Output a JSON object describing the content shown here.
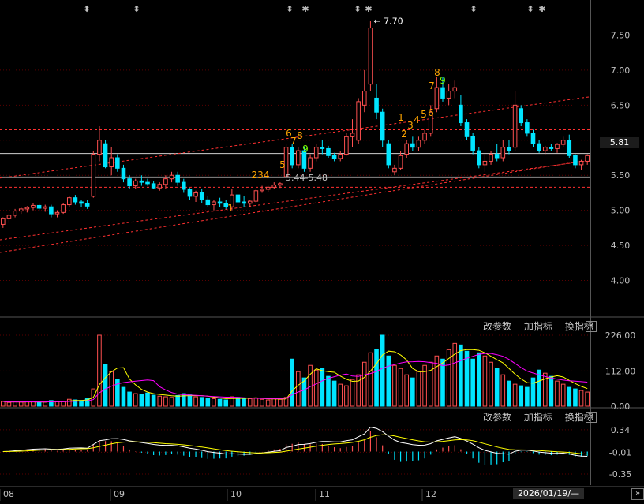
{
  "chart_data": [
    {
      "type": "candlestick",
      "title": "",
      "ylim": [
        3.5,
        8.0
      ],
      "y_ticks": [
        "7.50",
        "7.00",
        "6.50",
        "6.00",
        "5.50",
        "5.00",
        "4.50",
        "4.00"
      ],
      "y_tick_values": [
        7.5,
        7.0,
        6.5,
        6.0,
        5.5,
        5.0,
        4.5,
        4.0
      ],
      "x_ticks": [
        "08",
        "09",
        "10",
        "11",
        "12"
      ],
      "last_price": "5.81",
      "peak_label": "7.70",
      "range_label": "5.44-5.48",
      "horizontal_lines": [
        6.15,
        5.81,
        5.47,
        5.33
      ],
      "candles": [
        [
          4.8,
          4.9,
          4.75,
          4.88
        ],
        [
          4.88,
          4.95,
          4.82,
          4.93
        ],
        [
          4.93,
          5.02,
          4.9,
          4.99
        ],
        [
          4.99,
          5.05,
          4.95,
          5.02
        ],
        [
          5.02,
          5.06,
          4.97,
          5.04
        ],
        [
          5.04,
          5.1,
          5.0,
          5.07
        ],
        [
          5.07,
          5.09,
          5.0,
          5.03
        ],
        [
          5.03,
          5.08,
          4.98,
          5.05
        ],
        [
          5.05,
          5.08,
          4.9,
          4.95
        ],
        [
          4.95,
          5.0,
          4.9,
          4.97
        ],
        [
          4.97,
          5.1,
          4.95,
          5.08
        ],
        [
          5.08,
          5.2,
          5.05,
          5.18
        ],
        [
          5.18,
          5.22,
          5.08,
          5.12
        ],
        [
          5.12,
          5.15,
          5.05,
          5.1
        ],
        [
          5.1,
          5.15,
          5.02,
          5.06
        ],
        [
          5.2,
          5.85,
          5.18,
          5.8
        ],
        [
          5.8,
          6.2,
          5.7,
          6.0
        ],
        [
          5.95,
          6.0,
          5.6,
          5.62
        ],
        [
          5.62,
          5.9,
          5.5,
          5.75
        ],
        [
          5.75,
          5.8,
          5.55,
          5.6
        ],
        [
          5.6,
          5.65,
          5.4,
          5.45
        ],
        [
          5.45,
          5.5,
          5.3,
          5.35
        ],
        [
          5.35,
          5.45,
          5.3,
          5.42
        ],
        [
          5.42,
          5.5,
          5.35,
          5.4
        ],
        [
          5.4,
          5.45,
          5.35,
          5.38
        ],
        [
          5.38,
          5.42,
          5.3,
          5.32
        ],
        [
          5.32,
          5.4,
          5.28,
          5.37
        ],
        [
          5.37,
          5.5,
          5.3,
          5.45
        ],
        [
          5.45,
          5.55,
          5.4,
          5.5
        ],
        [
          5.5,
          5.55,
          5.35,
          5.4
        ],
        [
          5.4,
          5.45,
          5.25,
          5.3
        ],
        [
          5.3,
          5.32,
          5.15,
          5.2
        ],
        [
          5.2,
          5.28,
          5.12,
          5.25
        ],
        [
          5.25,
          5.3,
          5.1,
          5.15
        ],
        [
          5.15,
          5.2,
          5.05,
          5.08
        ],
        [
          5.08,
          5.15,
          5.0,
          5.12
        ],
        [
          5.12,
          5.18,
          5.05,
          5.1
        ],
        [
          5.1,
          5.15,
          5.02,
          5.05
        ],
        [
          5.05,
          5.3,
          5.0,
          5.22
        ],
        [
          5.22,
          5.25,
          5.1,
          5.12
        ],
        [
          5.12,
          5.2,
          5.05,
          5.1
        ],
        [
          5.1,
          5.15,
          5.05,
          5.13
        ],
        [
          5.13,
          5.3,
          5.1,
          5.28
        ],
        [
          5.28,
          5.35,
          5.25,
          5.3
        ],
        [
          5.3,
          5.35,
          5.26,
          5.33
        ],
        [
          5.33,
          5.4,
          5.3,
          5.36
        ],
        [
          5.36,
          5.4,
          5.32,
          5.38
        ],
        [
          5.48,
          5.95,
          5.45,
          5.9
        ],
        [
          5.9,
          5.95,
          5.6,
          5.65
        ],
        [
          5.65,
          5.9,
          5.6,
          5.85
        ],
        [
          5.85,
          5.9,
          5.55,
          5.6
        ],
        [
          5.6,
          5.8,
          5.55,
          5.75
        ],
        [
          5.75,
          5.95,
          5.7,
          5.9
        ],
        [
          5.9,
          6.0,
          5.8,
          5.88
        ],
        [
          5.88,
          5.92,
          5.75,
          5.78
        ],
        [
          5.78,
          5.82,
          5.7,
          5.74
        ],
        [
          5.74,
          5.85,
          5.7,
          5.8
        ],
        [
          5.8,
          6.1,
          5.78,
          6.05
        ],
        [
          6.05,
          6.3,
          5.9,
          6.1
        ],
        [
          6.0,
          6.6,
          5.95,
          6.55
        ],
        [
          6.5,
          7.0,
          6.4,
          6.7
        ],
        [
          6.8,
          7.7,
          6.7,
          7.6
        ],
        [
          6.6,
          6.8,
          6.3,
          6.4
        ],
        [
          6.4,
          6.45,
          5.9,
          6.0
        ],
        [
          5.95,
          6.0,
          5.6,
          5.65
        ],
        [
          5.55,
          5.65,
          5.5,
          5.6
        ],
        [
          5.6,
          5.85,
          5.58,
          5.78
        ],
        [
          5.8,
          6.0,
          5.75,
          5.95
        ],
        [
          5.95,
          6.05,
          5.85,
          5.9
        ],
        [
          5.9,
          6.05,
          5.85,
          6.0
        ],
        [
          6.0,
          6.15,
          5.95,
          6.1
        ],
        [
          6.1,
          6.5,
          6.05,
          6.4
        ],
        [
          6.45,
          6.9,
          6.4,
          6.75
        ],
        [
          6.75,
          6.9,
          6.55,
          6.6
        ],
        [
          6.6,
          6.8,
          6.5,
          6.7
        ],
        [
          6.7,
          6.85,
          6.6,
          6.75
        ],
        [
          6.5,
          6.65,
          6.2,
          6.25
        ],
        [
          6.25,
          6.3,
          6.0,
          6.05
        ],
        [
          6.05,
          6.1,
          5.8,
          5.85
        ],
        [
          5.85,
          5.9,
          5.6,
          5.65
        ],
        [
          5.65,
          5.8,
          5.55,
          5.7
        ],
        [
          5.7,
          5.85,
          5.65,
          5.8
        ],
        [
          5.8,
          5.95,
          5.7,
          5.75
        ],
        [
          5.75,
          6.0,
          5.7,
          5.9
        ],
        [
          5.9,
          6.0,
          5.8,
          5.85
        ],
        [
          5.9,
          6.7,
          5.85,
          6.5
        ],
        [
          6.45,
          6.5,
          6.2,
          6.25
        ],
        [
          6.25,
          6.3,
          6.05,
          6.1
        ],
        [
          6.1,
          6.15,
          5.9,
          5.95
        ],
        [
          5.95,
          6.0,
          5.82,
          5.85
        ],
        [
          5.85,
          5.92,
          5.8,
          5.9
        ],
        [
          5.9,
          5.95,
          5.84,
          5.88
        ],
        [
          5.88,
          5.96,
          5.82,
          5.94
        ],
        [
          5.94,
          6.05,
          5.9,
          6.0
        ],
        [
          6.0,
          6.08,
          5.75,
          5.78
        ],
        [
          5.78,
          5.8,
          5.6,
          5.65
        ],
        [
          5.65,
          5.72,
          5.58,
          5.7
        ],
        [
          5.7,
          5.8,
          5.65,
          5.78
        ]
      ]
    },
    {
      "type": "bar",
      "title": "",
      "y_ticks": [
        "226.00",
        "112.00",
        "0.00"
      ],
      "y_tick_values": [
        226,
        112,
        0
      ],
      "ylim": [
        0,
        226
      ],
      "values": [
        15,
        12,
        14,
        13,
        15,
        14,
        12,
        13,
        18,
        14,
        16,
        22,
        20,
        18,
        24,
        55,
        226,
        132,
        110,
        85,
        60,
        45,
        40,
        38,
        42,
        35,
        32,
        30,
        28,
        34,
        40,
        36,
        30,
        28,
        26,
        24,
        22,
        20,
        30,
        28,
        26,
        24,
        26,
        22,
        20,
        24,
        22,
        28,
        150,
        110,
        90,
        130,
        115,
        120,
        95,
        80,
        70,
        65,
        85,
        100,
        140,
        170,
        180,
        226,
        160,
        130,
        120,
        100,
        90,
        110,
        130,
        140,
        160,
        150,
        180,
        200,
        195,
        175,
        150,
        170,
        160,
        140,
        120,
        100,
        80,
        70,
        65,
        60,
        90,
        115,
        105,
        95,
        80,
        70,
        60,
        55,
        50,
        45,
        40,
        38
      ],
      "ma_fast": [],
      "ma_slow": []
    },
    {
      "type": "bar",
      "title": "",
      "y_ticks": [
        "0.34",
        "-0.01",
        "-0.35"
      ],
      "y_tick_values": [
        0.34,
        -0.01,
        -0.35
      ],
      "ylim": [
        -0.4,
        0.4
      ]
    }
  ],
  "panels": {
    "volume_header": {
      "edit_params": "改参数",
      "add_indicator": "加指标",
      "switch_indicator": "换指标",
      "close": "✕"
    },
    "macd_header": {
      "edit_params": "改参数",
      "add_indicator": "加指标",
      "switch_indicator": "换指标",
      "close": "✕"
    }
  },
  "status": {
    "cursor_date": "2026/01/19/—"
  },
  "markers": {
    "top_arrows": [
      "⬍",
      "⬍",
      "⬍",
      "⬍",
      "⬍",
      "⬍"
    ],
    "top_stars": [
      "✱",
      "✱",
      "✱"
    ],
    "counts": [
      {
        "text": "1",
        "color": "#ffa500"
      },
      {
        "text": "234",
        "color": "#ffa500"
      },
      {
        "text": "5",
        "color": "#ffa500"
      },
      {
        "text": "6",
        "color": "#ffa500"
      },
      {
        "text": "7",
        "color": "#ffa500"
      },
      {
        "text": "8",
        "color": "#ffa500"
      },
      {
        "text": "9",
        "color": "#7cfc00"
      },
      {
        "text": "1",
        "color": "#ffa500"
      },
      {
        "text": "2",
        "color": "#ffa500"
      },
      {
        "text": "3",
        "color": "#ffa500"
      },
      {
        "text": "4",
        "color": "#ffa500"
      },
      {
        "text": "5",
        "color": "#ffa500"
      },
      {
        "text": "6",
        "color": "#ffa500"
      },
      {
        "text": "7",
        "color": "#ffa500"
      },
      {
        "text": "8",
        "color": "#ffa500"
      },
      {
        "text": "9",
        "color": "#7cfc00"
      },
      {
        "text": "1",
        "color": "#ffa500"
      }
    ]
  },
  "colors": {
    "up": "#ff5050",
    "down": "#00e5ff",
    "ma_fast": "#ffffff",
    "ma_slow": "#ffff00",
    "ma_vol": "#ff00ff",
    "grid": "#5a0000"
  }
}
